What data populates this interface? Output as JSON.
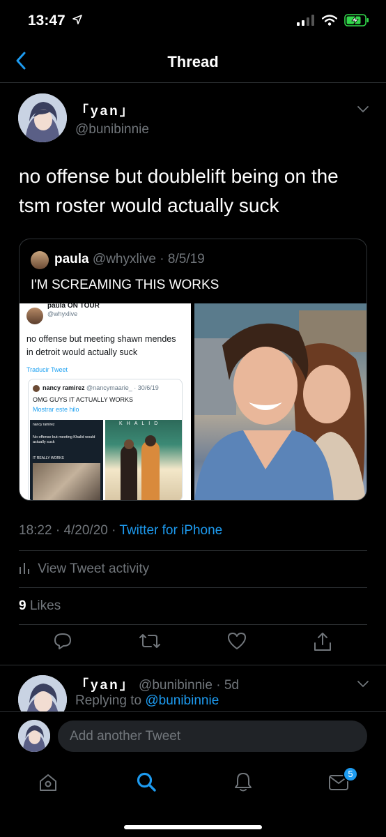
{
  "status_bar": {
    "time": "13:47"
  },
  "header": {
    "title": "Thread"
  },
  "tweet": {
    "display_name": "「yan」",
    "handle": "@bunibinnie",
    "text": "no offense but doublelift being on the tsm roster would actually suck",
    "time": "18:22",
    "date": "4/20/20",
    "source": "Twitter for iPhone",
    "activity_label": "View Tweet activity",
    "likes_count": "9",
    "likes_label": "Likes"
  },
  "quoted_tweet": {
    "display_name": "paula",
    "handle": "@whyxlive",
    "date": "8/5/19",
    "text": "I'M SCREAMING THIS WORKS",
    "screenshot": {
      "name": "paula ON TOUR",
      "handle": "@whyxlive",
      "text": "no offense but meeting shawn mendes in detroit would actually suck",
      "translate": "Traducir Tweet",
      "inner_name": "nancy ramirez",
      "inner_handle": "@nancymaarie_",
      "inner_date": "30/6/19",
      "inner_text": "OMG GUYS IT ACTUALLY WORKS",
      "inner_show": "Mostrar este hilo",
      "mini_name": "nancy ramirez",
      "mini_text": "No offense but meeting Khalid would actually suck",
      "mini_works": "IT REALLY WORKS",
      "banner": "KHALID"
    }
  },
  "reply": {
    "display_name": "「yan」",
    "handle": "@bunibinnie",
    "age": "5d",
    "replying_prefix": "Replying to",
    "replying_to": "@bunibinnie"
  },
  "composer": {
    "placeholder": "Add another Tweet"
  },
  "tabbar": {
    "messages_badge": "5"
  },
  "colors": {
    "accent": "#1d9bf0",
    "background": "#000000",
    "muted": "#71767b",
    "battery": "#32d74b"
  }
}
